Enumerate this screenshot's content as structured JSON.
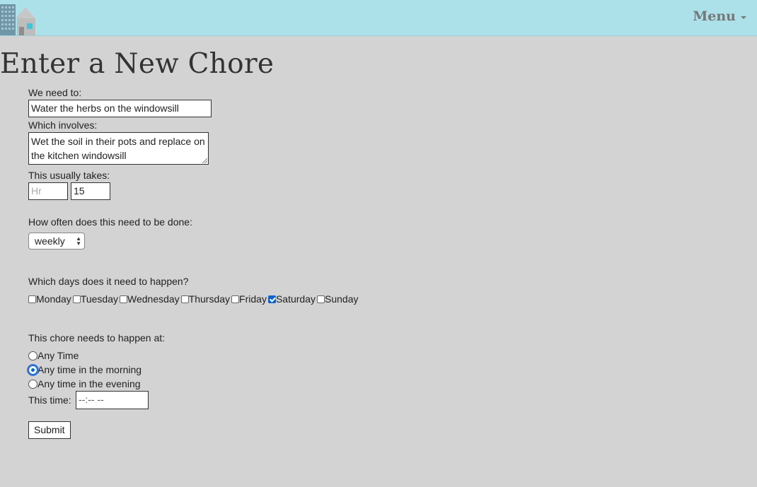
{
  "navbar": {
    "menu_label": "Menu",
    "logo_icon": "house-building-icon",
    "menu_icon": "caret-down-icon"
  },
  "page": {
    "title": "Enter a New Chore"
  },
  "form": {
    "name_label": "We need to:",
    "name_value": "Water the herbs on the windowsill",
    "desc_label": "Which involves:",
    "desc_value": "Wet the soil in their pots and replace on the kitchen windowsill",
    "duration_label": "This usually takes:",
    "hours_placeholder": "Hr",
    "hours_value": "",
    "minutes_value": "15",
    "frequency_label": "How often does this need to be done:",
    "frequency_value": "weekly",
    "days_label": "Which days does it need to happen?",
    "days": [
      {
        "label": "Monday",
        "checked": false
      },
      {
        "label": "Tuesday",
        "checked": false
      },
      {
        "label": "Wednesday",
        "checked": false
      },
      {
        "label": "Thursday",
        "checked": false
      },
      {
        "label": "Friday",
        "checked": false
      },
      {
        "label": "Saturday",
        "checked": true
      },
      {
        "label": "Sunday",
        "checked": false
      }
    ],
    "time_label": "This chore needs to happen at:",
    "time_options": [
      {
        "label": "Any Time",
        "selected": false
      },
      {
        "label": "Any time in the morning",
        "selected": true
      },
      {
        "label": "Any time in the evening",
        "selected": false
      }
    ],
    "specific_time_label": "This time:",
    "specific_time_value": "--:-- --",
    "submit_label": "Submit"
  },
  "colors": {
    "navbar": "#ade1ea",
    "background": "#d3d3d3",
    "accent": "#0b63ce"
  }
}
